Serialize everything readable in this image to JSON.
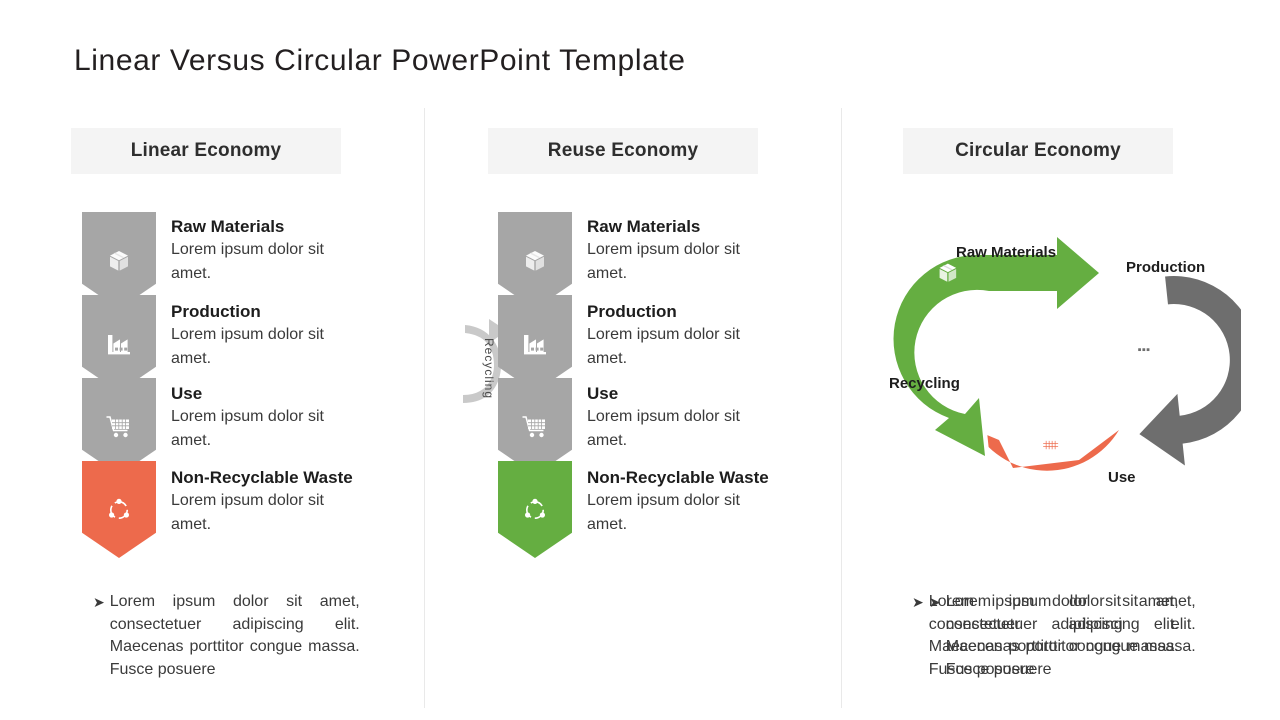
{
  "slide": {
    "title": "Linear Versus Circular PowerPoint Template"
  },
  "colors": {
    "gray": "#a6a6a6",
    "orange": "#ed6a4c",
    "green": "#65ae41",
    "dark_gray": "#6e6e6e",
    "header_bg": "#f4f4f4",
    "divider": "#e9e9e9",
    "text": "#3a3a3a"
  },
  "bullet_marker": "➤",
  "bullet_text": "Lorem ipsum dolor sit amet, consectetuer adipiscing elit. Maecenas porttitor congue massa. Fusce posuere",
  "columns": [
    {
      "header": "Linear Economy",
      "steps": [
        {
          "title": "Raw Materials",
          "desc": "Lorem ipsum dolor sit amet.",
          "icon": "box-icon",
          "color": "gray"
        },
        {
          "title": "Production",
          "desc": "Lorem ipsum dolor sit amet.",
          "icon": "factory-icon",
          "color": "gray"
        },
        {
          "title": "Use",
          "desc": "Lorem ipsum dolor sit amet.",
          "icon": "shopping-cart-icon",
          "color": "gray"
        },
        {
          "title": "Non-Recyclable  Waste",
          "desc": "Lorem ipsum dolor sit amet.",
          "icon": "recycle-icon",
          "color": "orange"
        }
      ]
    },
    {
      "header": "Reuse Economy",
      "recycling_label": "Recycling",
      "steps": [
        {
          "title": "Raw Materials",
          "desc": "Lorem ipsum dolor sit amet.",
          "icon": "box-icon",
          "color": "gray"
        },
        {
          "title": "Production",
          "desc": "Lorem ipsum dolor sit amet.",
          "icon": "factory-icon",
          "color": "gray"
        },
        {
          "title": "Use",
          "desc": "Lorem ipsum dolor sit amet.",
          "icon": "shopping-cart-icon",
          "color": "gray"
        },
        {
          "title": "Non-Recyclable  Waste",
          "desc": "Lorem ipsum dolor sit amet.",
          "icon": "recycle-icon",
          "color": "green"
        }
      ]
    },
    {
      "header": "Circular Economy",
      "cycle_labels": {
        "raw_materials": "Raw Materials",
        "production": "Production",
        "recycling": "Recycling",
        "use": "Use"
      }
    }
  ]
}
